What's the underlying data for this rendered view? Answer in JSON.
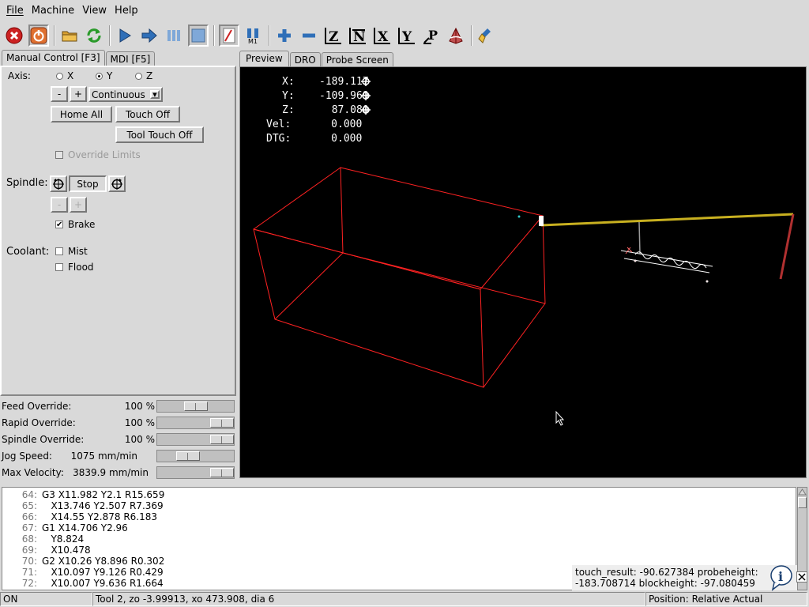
{
  "menu": [
    "File",
    "Machine",
    "View",
    "Help"
  ],
  "toolbar": {
    "icons": [
      "estop-icon",
      "power-icon",
      "open-file-icon",
      "reload-icon",
      "run-icon",
      "step-icon",
      "pause-icon",
      "stop-icon",
      "block-delete-icon",
      "optional-stop-icon",
      "zoom-in-icon",
      "zoom-out-icon",
      "view-z-icon",
      "view-z-rotated-icon",
      "view-x-icon",
      "view-y-icon",
      "view-p-icon",
      "perspective-icon",
      "clear-plot-icon"
    ],
    "optional_stop_label": "M1"
  },
  "left_tabs": [
    "Manual Control [F3]",
    "MDI [F5]"
  ],
  "manual": {
    "axis_label": "Axis:",
    "axes": [
      "X",
      "Y",
      "Z"
    ],
    "selected_axis": "Y",
    "jog_minus": "-",
    "jog_plus": "+",
    "jog_mode": "Continuous",
    "home_all": "Home All",
    "touch_off": "Touch Off",
    "tool_touch_off": "Tool Touch Off",
    "override_limits": "Override Limits",
    "spindle_label": "Spindle:",
    "spindle_stop": "Stop",
    "spindle_minus": "-",
    "spindle_plus": "+",
    "brake": "Brake",
    "brake_checked": true,
    "coolant_label": "Coolant:",
    "mist": "Mist",
    "flood": "Flood",
    "check_mark": "✔"
  },
  "overrides": [
    {
      "label": "Feed Override:",
      "value": "100 %",
      "fraction": 0.5
    },
    {
      "label": "Rapid Override:",
      "value": "100 %",
      "fraction": 1.0
    },
    {
      "label": "Spindle Override:",
      "value": "100 %",
      "fraction": 1.0
    },
    {
      "label": "Jog Speed:",
      "value": "1075 mm/min",
      "fraction": 0.36
    },
    {
      "label": "Max Velocity:",
      "value": "3839.9 mm/min",
      "fraction": 1.0
    }
  ],
  "right_tabs": [
    "Preview",
    "DRO",
    "Probe Screen"
  ],
  "dro": [
    {
      "label": "X:",
      "value": "-189.117"
    },
    {
      "label": "Y:",
      "value": "-109.969"
    },
    {
      "label": "Z:",
      "value": "87.080"
    },
    {
      "label": "Vel:",
      "value": "0.000"
    },
    {
      "label": "DTG:",
      "value": "0.000"
    }
  ],
  "gcode": [
    {
      "n": "64:",
      "text": "G3 X11.982 Y2.1 R15.659"
    },
    {
      "n": "65:",
      "text": "   X13.746 Y2.507 R7.369"
    },
    {
      "n": "66:",
      "text": "   X14.55 Y2.878 R6.183"
    },
    {
      "n": "67:",
      "text": "G1 X14.706 Y2.96"
    },
    {
      "n": "68:",
      "text": "   Y8.824"
    },
    {
      "n": "69:",
      "text": "   X10.478"
    },
    {
      "n": "70:",
      "text": "G2 X10.26 Y8.896 R0.302"
    },
    {
      "n": "71:",
      "text": "   X10.097 Y9.126 R0.429"
    },
    {
      "n": "72:",
      "text": "   X10.007 Y9.636 R1.664"
    }
  ],
  "touch_info": {
    "line1": "touch_result: -90.627384  probeheight:",
    "line2": "-183.708714  blockheight: -97.080459"
  },
  "status": {
    "machine": "ON",
    "tool": "Tool 2, zo -3.99913, xo 473.908, dia 6",
    "position": "Position: Relative Actual"
  },
  "colors": {
    "accent_red": "#cc2222",
    "accent_blue": "#2f6fb8",
    "path_yellow": "#c8b020",
    "box_red": "#ff2222"
  }
}
